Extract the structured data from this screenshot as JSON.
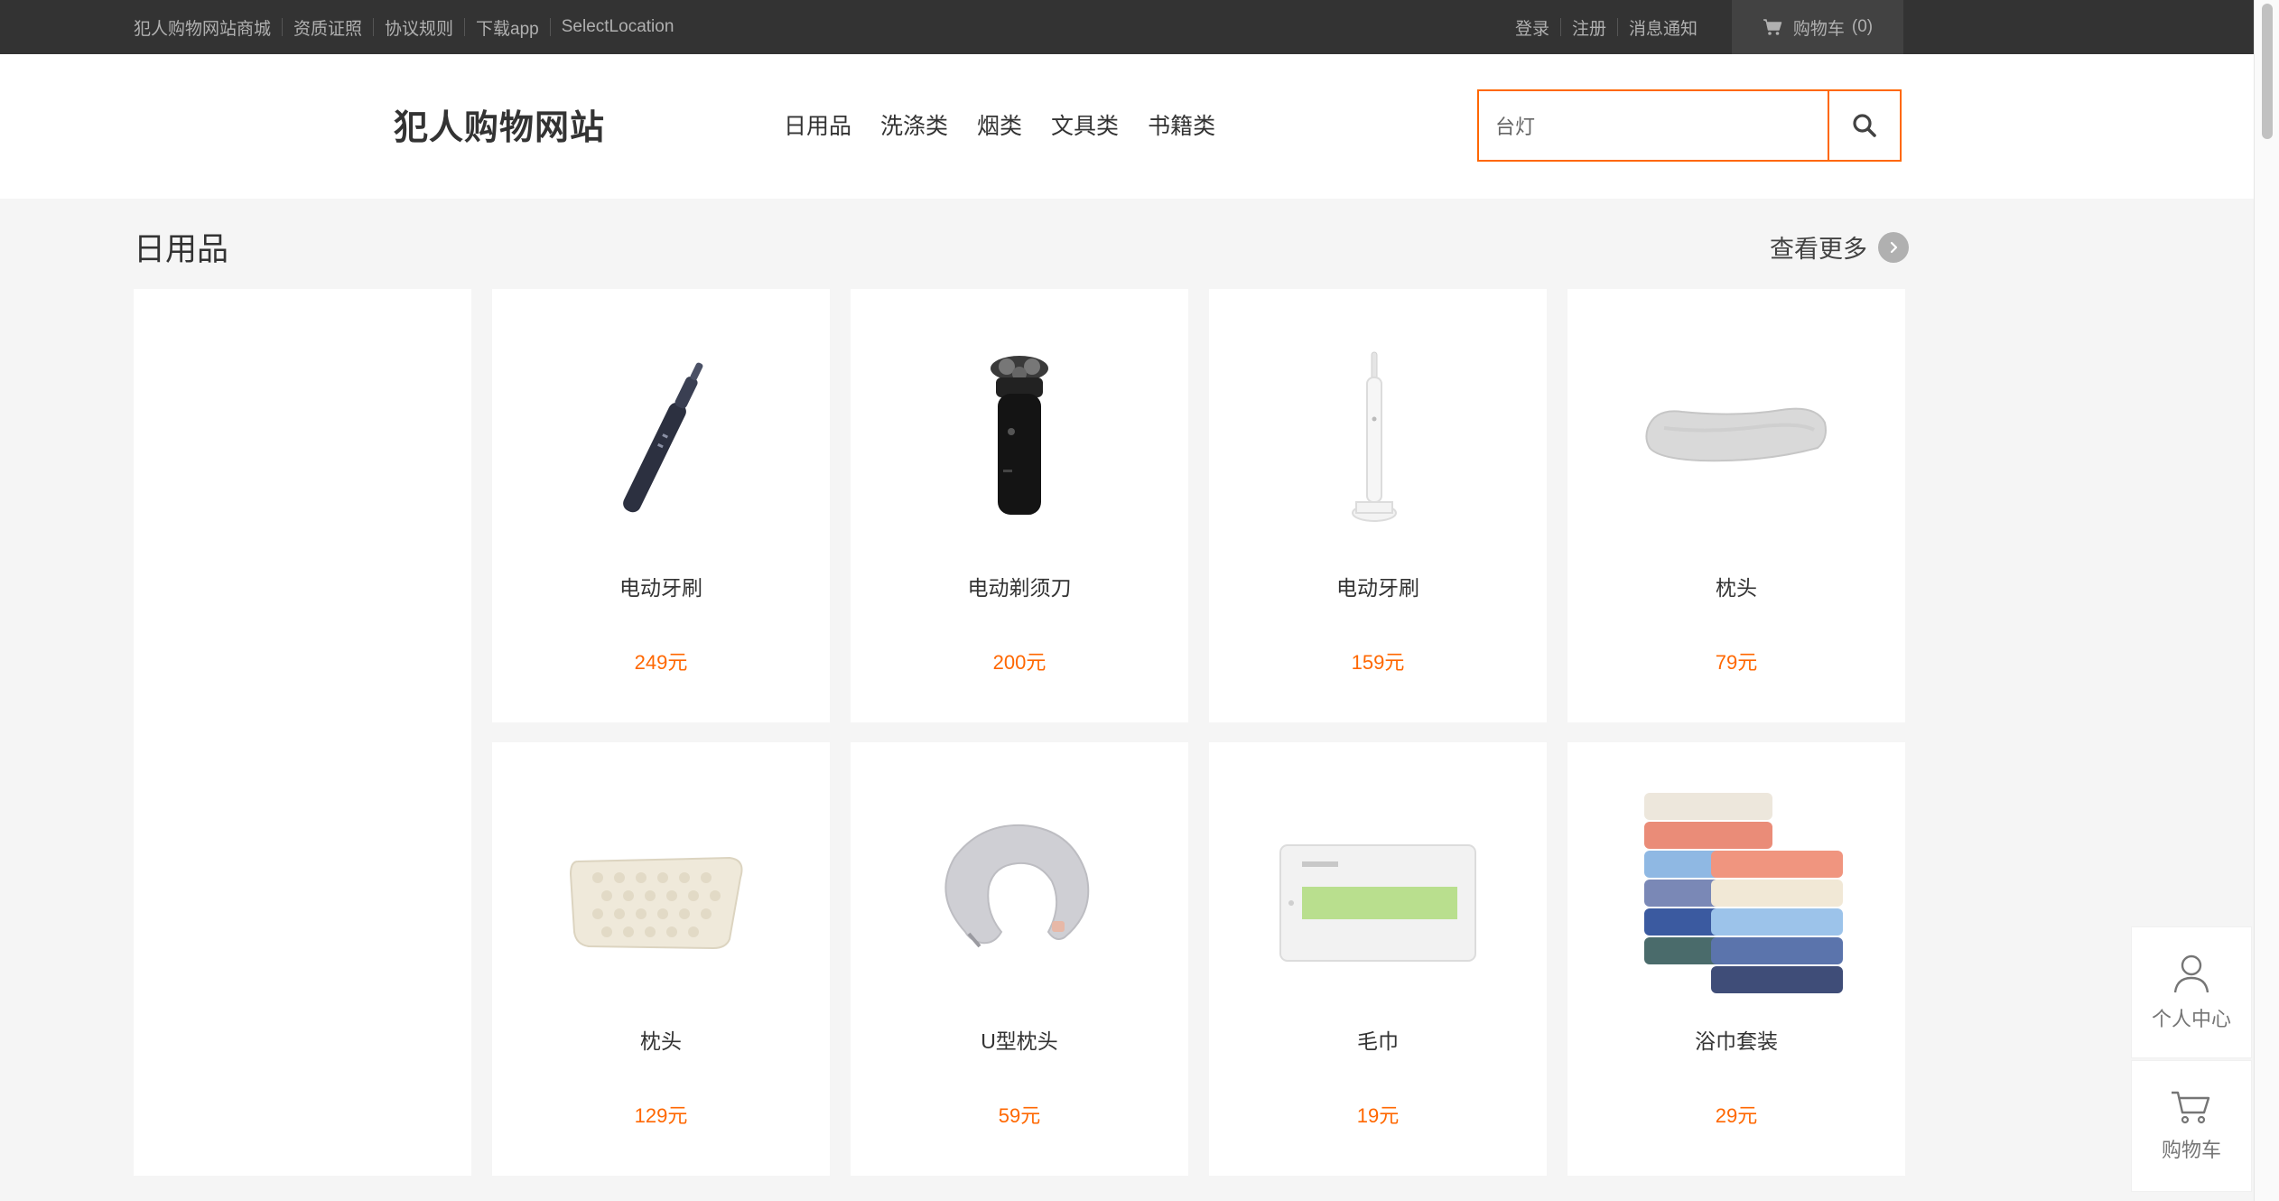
{
  "topbar": {
    "links": [
      "犯人购物网站商城",
      "资质证照",
      "协议规则",
      "下载app",
      "SelectLocation"
    ],
    "right_links": [
      "登录",
      "注册",
      "消息通知"
    ],
    "cart_label": "购物车",
    "cart_count": "(0)"
  },
  "header": {
    "logo": "犯人购物网站",
    "nav": [
      "日用品",
      "洗涤类",
      "烟类",
      "文具类",
      "书籍类"
    ],
    "search": {
      "value": "台灯",
      "placeholder": "台灯"
    }
  },
  "section": {
    "title": "日用品",
    "more_label": "查看更多"
  },
  "products": [
    {
      "name": "电动牙刷",
      "price": "249元",
      "icon": "electric-toothbrush-dark"
    },
    {
      "name": "电动剃须刀",
      "price": "200元",
      "icon": "electric-shaver"
    },
    {
      "name": "电动牙刷",
      "price": "159元",
      "icon": "electric-toothbrush-white"
    },
    {
      "name": "枕头",
      "price": "79元",
      "icon": "memory-foam-pillow"
    },
    {
      "name": "枕头",
      "price": "129元",
      "icon": "latex-pillow"
    },
    {
      "name": "U型枕头",
      "price": "59元",
      "icon": "u-shaped-pillow"
    },
    {
      "name": "毛巾",
      "price": "19元",
      "icon": "towel-box"
    },
    {
      "name": "浴巾套装",
      "price": "29元",
      "icon": "bath-towel-set"
    }
  ],
  "float_bar": {
    "user_center": "个人中心",
    "cart": "购物车"
  },
  "colors": {
    "accent": "#ff6700",
    "topbar_bg": "#333333",
    "page_bg": "#f5f5f5"
  }
}
